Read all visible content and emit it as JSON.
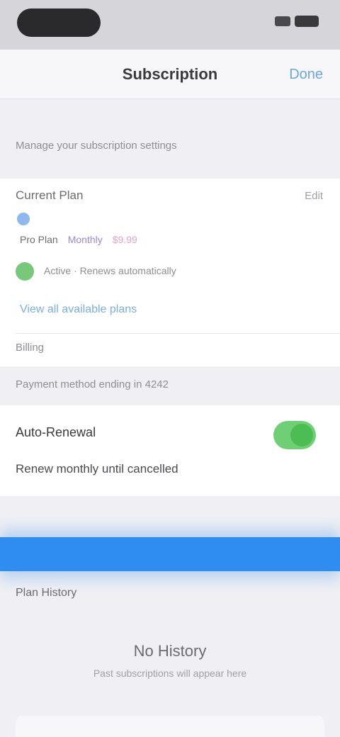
{
  "nav": {
    "title": "Subscription",
    "action": "Done"
  },
  "sections": {
    "top_note": "Manage your subscription settings",
    "card_a": {
      "header": "Current Plan",
      "header_right": "Edit",
      "detail": {
        "left": "Pro Plan",
        "mid": "Monthly",
        "right": "$9.99"
      },
      "green_line": "Active · Renews automatically",
      "link": "View all available plans",
      "small": "Billing"
    },
    "section_note_2": "Payment method ending in 4242",
    "card_b": {
      "title": "Auto-Renewal",
      "subtitle": "Renew monthly until cancelled",
      "toggle_on": true
    },
    "section_label": "Plan History",
    "center": {
      "title": "No History",
      "subtitle": "Past subscriptions will appear here"
    }
  },
  "colors": {
    "accent": "#2f8cf0",
    "toggle": "#4cbd53",
    "link": "#7aaee8"
  }
}
